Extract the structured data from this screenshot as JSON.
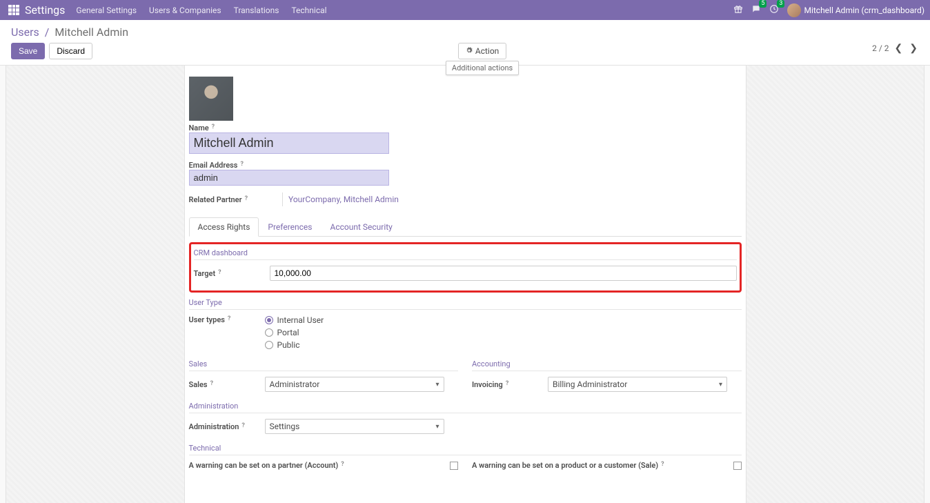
{
  "topbar": {
    "title": "Settings",
    "menu": [
      "General Settings",
      "Users & Companies",
      "Translations",
      "Technical"
    ],
    "msg_badge": "5",
    "clock_badge": "3",
    "user": "Mitchell Admin (crm_dashboard)"
  },
  "breadcrumb": {
    "root": "Users",
    "current": "Mitchell Admin"
  },
  "buttons": {
    "save": "Save",
    "discard": "Discard",
    "action": "Action",
    "tooltip": "Additional actions"
  },
  "pager": {
    "current": "2",
    "total": "2"
  },
  "form": {
    "name_label": "Name",
    "name_value": "Mitchell Admin",
    "email_label": "Email Address",
    "email_value": "admin",
    "partner_label": "Related Partner",
    "partner_value": "YourCompany, Mitchell Admin"
  },
  "tabs": [
    "Access Rights",
    "Preferences",
    "Account Security"
  ],
  "sections": {
    "crm_title": "CRM dashboard",
    "target_label": "Target",
    "target_value": "10,000.00",
    "usertype_title": "User Type",
    "usertypes_label": "User types",
    "usertype_options": [
      "Internal User",
      "Portal",
      "Public"
    ],
    "sales_title": "Sales",
    "sales_label": "Sales",
    "sales_value": "Administrator",
    "accounting_title": "Accounting",
    "invoicing_label": "Invoicing",
    "invoicing_value": "Billing Administrator",
    "admin_title": "Administration",
    "admin_label": "Administration",
    "admin_value": "Settings",
    "technical_title": "Technical",
    "warn_partner": "A warning can be set on a partner (Account)",
    "warn_product": "A warning can be set on a product or a customer (Sale)"
  }
}
